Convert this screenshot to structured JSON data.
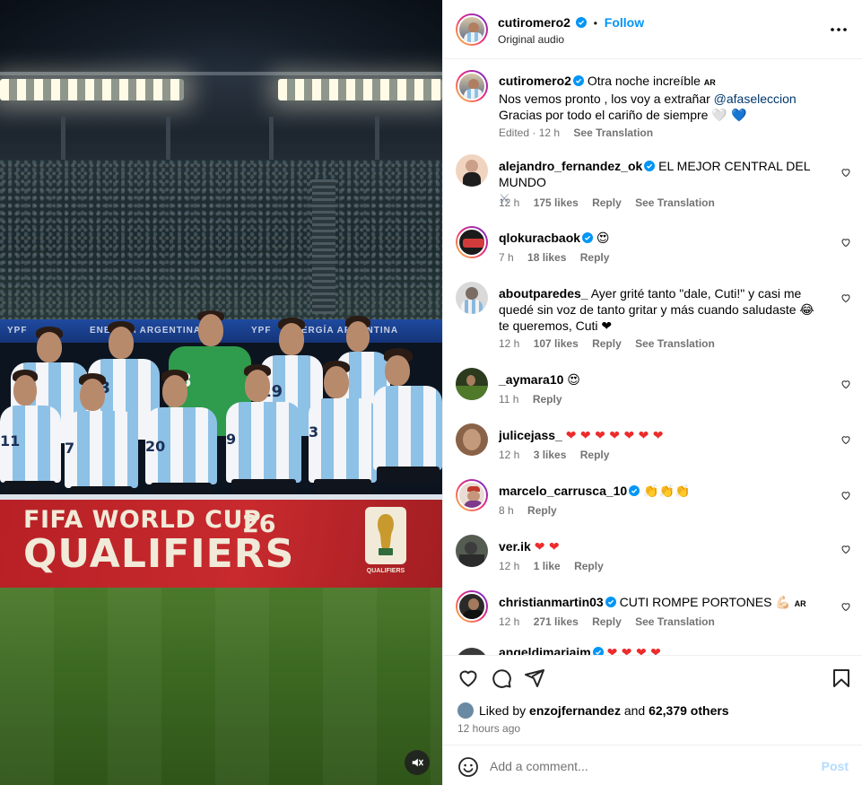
{
  "post": {
    "username": "cutiromero2",
    "follow_label": "Follow",
    "separator": "•",
    "audio": "Original audio",
    "more_icon": "more-options-icon"
  },
  "media": {
    "banner_line1": "FIFA WORLD CUP",
    "banner_line2": "QUALIFIERS",
    "banner_year": "26",
    "banner_logo_text": "QUALIFIERS",
    "ad_text_1": "YPF",
    "ad_text_2": "ENERGÍA ARGENTINA",
    "ad_text_3": "YPF",
    "ad_text_4": "ENERGÍA ARGENTINA",
    "player_numbers": [
      "13",
      "23",
      "19",
      "20",
      "9",
      "3",
      "7",
      "11"
    ],
    "mute_icon": "speaker-muted-icon"
  },
  "caption": {
    "username": "cutiromero2",
    "line1": "Otra noche increíble",
    "flag_code": "AR",
    "line2_pre": "Nos vemos pronto , los voy a extrañar",
    "mention": "@afaseleccion",
    "line3": "Gracias por todo el cariño de siempre",
    "line3_emoji": "🤍 💙",
    "edited": "Edited · 12 h",
    "see_translation": "See Translation"
  },
  "comments": [
    {
      "username": "alejandro_fernandez_ok",
      "verified": true,
      "text": "EL MEJOR CENTRAL DEL MUNDO",
      "text2": "⚔",
      "time": "12 h",
      "likes": "175 likes",
      "reply": "Reply",
      "translate": "See Translation"
    },
    {
      "username": "qlokuracbaok",
      "verified": true,
      "text": "😍",
      "time": "7 h",
      "likes": "18 likes",
      "reply": "Reply"
    },
    {
      "username": "aboutparedes_",
      "verified": false,
      "text": "Ayer grité tanto \"dale, Cuti!\" y casi me quedé sin voz de tanto gritar y más cuando saludaste 😂 te queremos, Cuti ❤",
      "time": "12 h",
      "likes": "107 likes",
      "reply": "Reply",
      "translate": "See Translation"
    },
    {
      "username": "_aymara10",
      "verified": false,
      "text": "😍",
      "time": "11 h",
      "reply": "Reply"
    },
    {
      "username": "julicejass_",
      "verified": false,
      "text": "❤ ❤ ❤ ❤ ❤ ❤ ❤",
      "time": "12 h",
      "likes": "3 likes",
      "reply": "Reply"
    },
    {
      "username": "marcelo_carrusca_10",
      "verified": true,
      "text": "👏👏👏",
      "time": "8 h",
      "reply": "Reply"
    },
    {
      "username": "ver.ik",
      "verified": false,
      "text": "❤ ❤",
      "time": "12 h",
      "likes": "1 like",
      "reply": "Reply"
    },
    {
      "username": "christianmartin03",
      "verified": true,
      "text": "CUTI ROMPE PORTONES 💪🏻",
      "flag_code": "AR",
      "time": "12 h",
      "likes": "271 likes",
      "reply": "Reply",
      "translate": "See Translation"
    },
    {
      "username": "angeldimariajm",
      "verified": true,
      "text": "❤ ❤ ❤ ❤"
    }
  ],
  "actions": {
    "like_icon": "heart-icon",
    "comment_icon": "comment-bubble-icon",
    "share_icon": "paper-plane-icon",
    "save_icon": "bookmark-icon",
    "liked_by_prefix": "Liked by",
    "liked_by_user": "enzojfernandez",
    "liked_by_and": "and",
    "liked_by_others": "62,379 others",
    "time_ago": "12 hours ago"
  },
  "add_comment": {
    "placeholder": "Add a comment...",
    "post_label": "Post",
    "emoji_icon": "smiley-icon"
  },
  "colors": {
    "accent": "#0095f6",
    "post_disabled": "#b3dbff",
    "heart_red": "#ed2b2b",
    "banner_red": "#c82a2e"
  }
}
